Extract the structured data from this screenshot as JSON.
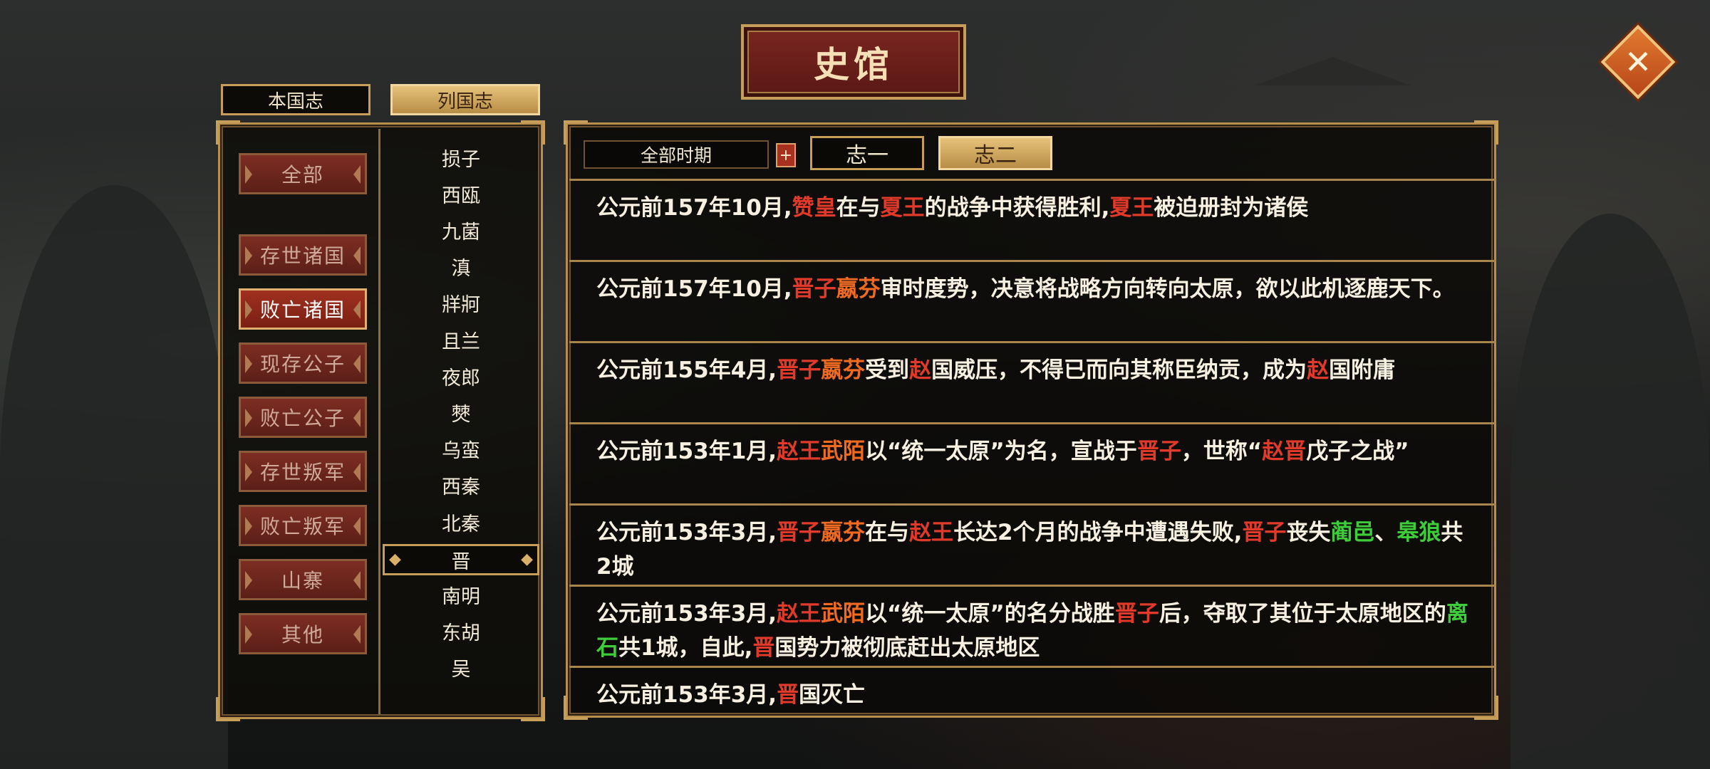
{
  "title": "史馆",
  "close_icon": "close-icon",
  "top_tabs": [
    {
      "label": "本国志",
      "active": false
    },
    {
      "label": "列国志",
      "active": true
    }
  ],
  "categories": [
    {
      "label": "全部",
      "active": false
    },
    {
      "label": "存世诸国",
      "active": false
    },
    {
      "label": "败亡诸国",
      "active": true
    },
    {
      "label": "现存公子",
      "active": false
    },
    {
      "label": "败亡公子",
      "active": false
    },
    {
      "label": "存世叛军",
      "active": false
    },
    {
      "label": "败亡叛军",
      "active": false
    },
    {
      "label": "山寨",
      "active": false
    },
    {
      "label": "其他",
      "active": false
    }
  ],
  "states": [
    "损子",
    "西瓯",
    "九菌",
    "滇",
    "牂牁",
    "且兰",
    "夜郎",
    "僰",
    "乌蛮",
    "西秦",
    "北秦",
    "晋",
    "南明",
    "东胡",
    "吴"
  ],
  "selected_state": "晋",
  "filter": {
    "period": "全部时期",
    "plus_label": "+",
    "volumes": [
      {
        "label": "志一",
        "active": false
      },
      {
        "label": "志二",
        "active": true
      }
    ]
  },
  "colors": {
    "person_red": "#e23a2a",
    "person_orange": "#f06a22",
    "city_green": "#3fcc3a",
    "gold_border": "#c79d5a"
  },
  "records": [
    [
      {
        "t": "公元前157年10月,"
      },
      {
        "t": "赞皇",
        "c": "r"
      },
      {
        "t": "在与"
      },
      {
        "t": "夏王",
        "c": "r"
      },
      {
        "t": "的战争中获得胜利,"
      },
      {
        "t": "夏王",
        "c": "r"
      },
      {
        "t": "被迫册封为诸侯"
      }
    ],
    [
      {
        "t": "公元前157年10月,"
      },
      {
        "t": "晋子",
        "c": "r"
      },
      {
        "t": "嬴芬",
        "c": "o"
      },
      {
        "t": "审时度势，决意将战略方向转向太原，欲以此机逐鹿天下。"
      }
    ],
    [
      {
        "t": "公元前155年4月,"
      },
      {
        "t": "晋子",
        "c": "r"
      },
      {
        "t": "嬴芬",
        "c": "o"
      },
      {
        "t": "受到"
      },
      {
        "t": "赵",
        "c": "r"
      },
      {
        "t": "国威压，不得已而向其称臣纳贡，成为"
      },
      {
        "t": "赵",
        "c": "r"
      },
      {
        "t": "国附庸"
      }
    ],
    [
      {
        "t": "公元前153年1月,"
      },
      {
        "t": "赵王",
        "c": "r"
      },
      {
        "t": "武陌",
        "c": "o"
      },
      {
        "t": "以“统一太原”为名，宣战于"
      },
      {
        "t": "晋子",
        "c": "r"
      },
      {
        "t": "，世称“"
      },
      {
        "t": "赵晋",
        "c": "r"
      },
      {
        "t": "戊子之战”"
      }
    ],
    [
      {
        "t": "公元前153年3月,"
      },
      {
        "t": "晋子",
        "c": "r"
      },
      {
        "t": "嬴芬",
        "c": "o"
      },
      {
        "t": "在与"
      },
      {
        "t": "赵王",
        "c": "r"
      },
      {
        "t": "长达2个月的战争中遭遇失败,"
      },
      {
        "t": "晋子",
        "c": "r"
      },
      {
        "t": "丧失"
      },
      {
        "t": "蔺邑",
        "c": "g"
      },
      {
        "t": "、"
      },
      {
        "t": "皋狼",
        "c": "g"
      },
      {
        "t": "共2城"
      }
    ],
    [
      {
        "t": "公元前153年3月,"
      },
      {
        "t": "赵王",
        "c": "r"
      },
      {
        "t": "武陌",
        "c": "o"
      },
      {
        "t": "以“统一太原”的名分战胜"
      },
      {
        "t": "晋子",
        "c": "r"
      },
      {
        "t": "后，夺取了其位于太原地区的"
      },
      {
        "t": "离石",
        "c": "g"
      },
      {
        "t": "共1城，自此,"
      },
      {
        "t": "晋",
        "c": "r"
      },
      {
        "t": "国势力被彻底赶出太原地区"
      }
    ],
    [
      {
        "t": "公元前153年3月,"
      },
      {
        "t": "晋",
        "c": "r"
      },
      {
        "t": "国灭亡"
      }
    ]
  ]
}
